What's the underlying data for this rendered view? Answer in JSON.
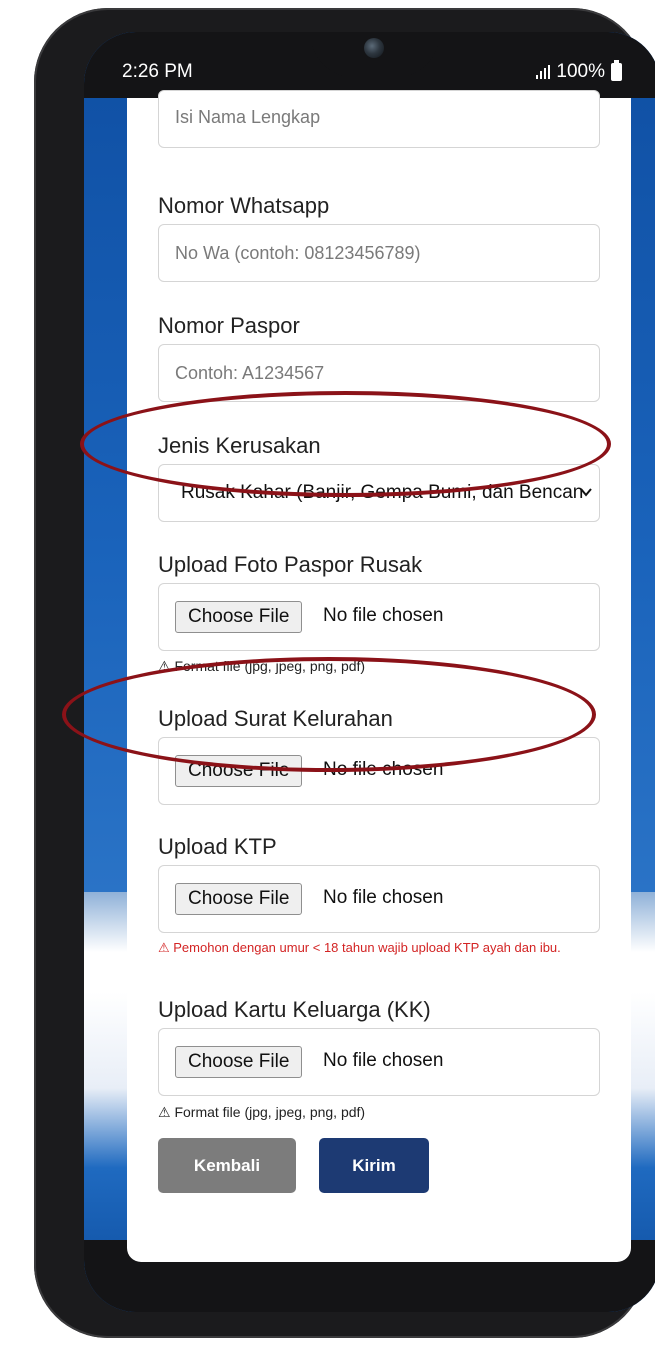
{
  "status_bar": {
    "time": "2:26 PM",
    "battery": "100%",
    "icons": [
      "signal-icon",
      "battery-icon"
    ]
  },
  "form": {
    "nama_placeholder": "Isi Nama Lengkap",
    "whatsapp_label": "Nomor Whatsapp",
    "whatsapp_placeholder": "No Wa (contoh: 08123456789)",
    "paspor_label": "Nomor Paspor",
    "paspor_placeholder": "Contoh: A1234567",
    "kerusakan_label": "Jenis Kerusakan",
    "kerusakan_value": "Rusak Kahar (Banjir, Gempa Bumi, dan Bencana Alam Lainnya)",
    "foto_paspor_label": "Upload Foto Paspor Rusak",
    "surat_kelurahan_label": "Upload Surat Kelurahan",
    "ktp_label": "Upload KTP",
    "kk_label": "Upload Kartu Keluarga (KK)",
    "choose_file": "Choose File",
    "no_file": "No file chosen",
    "format_hint": "⚠ Format file (jpg, jpeg, png, pdf)",
    "ktp_warning": "⚠ Pemohon dengan umur < 18 tahun wajib upload KTP ayah dan ibu."
  },
  "buttons": {
    "back": "Kembali",
    "send": "Kirim"
  },
  "colors": {
    "annotation": "#8b1218",
    "primary_button": "#1d3a73",
    "secondary_button": "#7c7c7c",
    "warning_text": "#d32424",
    "background_blue": "#0f4fa3"
  }
}
